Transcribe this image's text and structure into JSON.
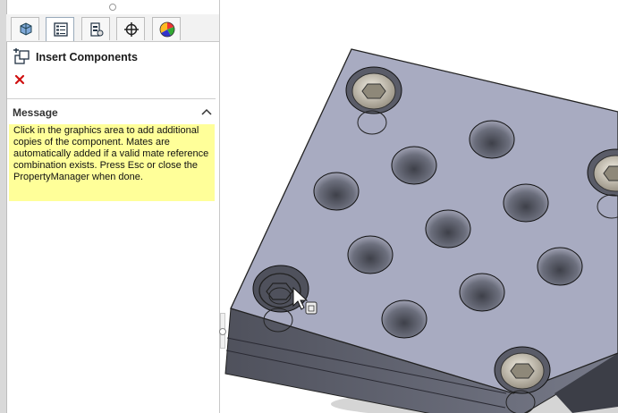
{
  "property_manager": {
    "title": "Insert Components",
    "close_label": "Cancel",
    "message": {
      "header": "Message",
      "text": "Click in the graphics area to add additional copies of the component. Mates are automatically added if a valid mate reference combination exists. Press Esc or close the PropertyManager when done."
    }
  },
  "tabs": [
    {
      "icon": "feature-manager-icon"
    },
    {
      "icon": "property-manager-icon",
      "active": true
    },
    {
      "icon": "configuration-manager-icon"
    },
    {
      "icon": "dimxpert-manager-icon"
    },
    {
      "icon": "display-manager-icon"
    }
  ],
  "colors": {
    "message_bg": "#ffff99",
    "part_top": "#a8abc1",
    "part_side": "#5f6170",
    "close_red": "#d01010"
  }
}
